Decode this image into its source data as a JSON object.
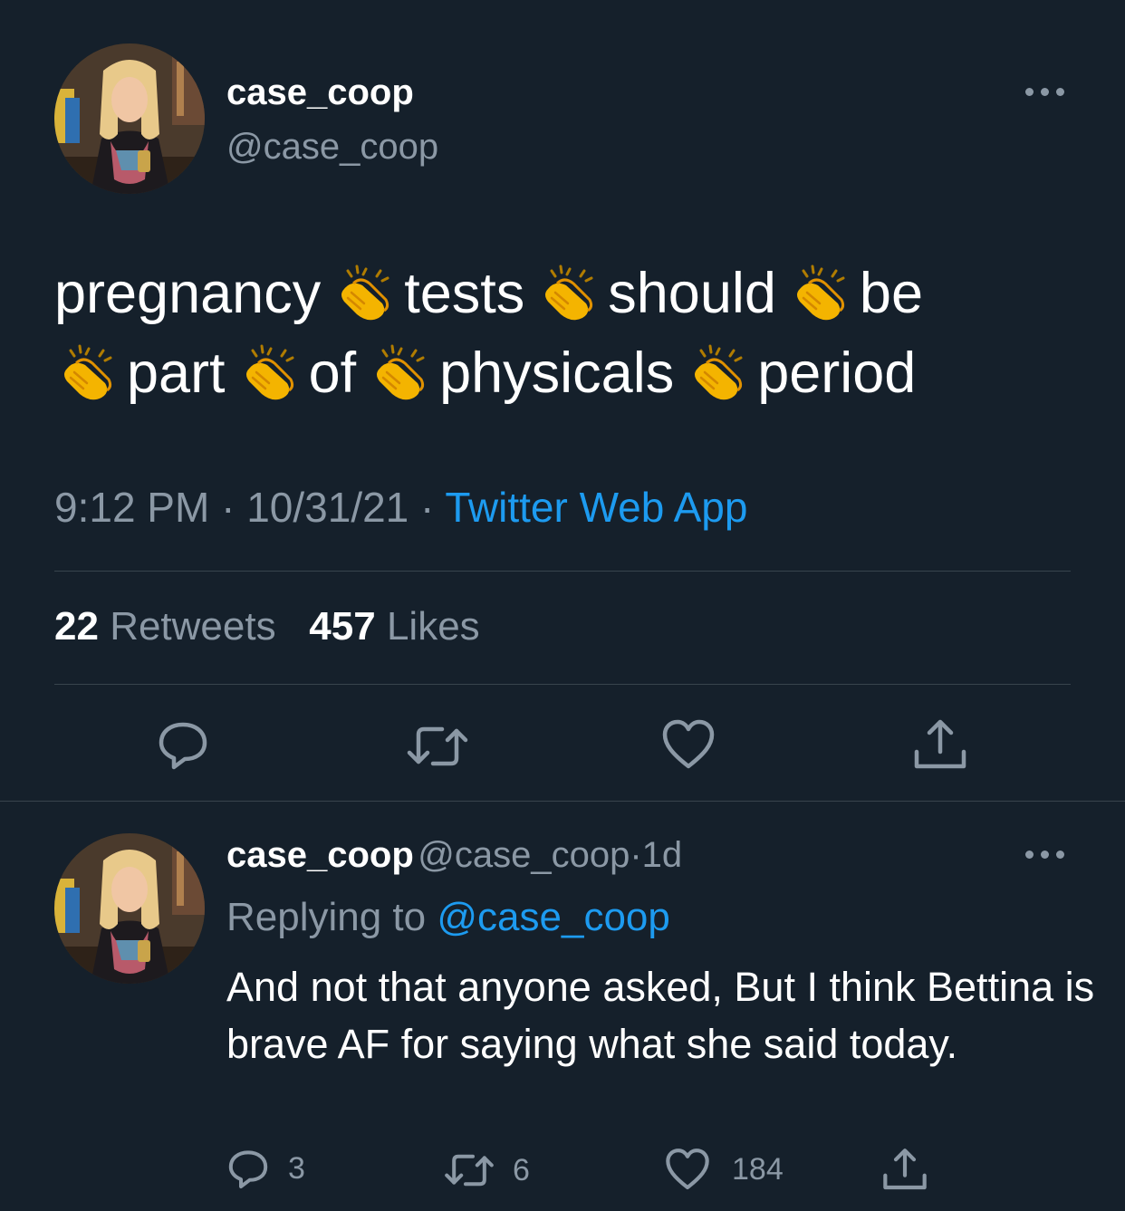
{
  "main_tweet": {
    "display_name": "case_coop",
    "handle": "@case_coop",
    "text_words": [
      "pregnancy",
      "tests",
      "should",
      "be",
      "part",
      "of",
      "physicals",
      "period"
    ],
    "emoji_icon": "clapping-hands-icon",
    "time": "9:12 PM",
    "date": "10/31/21",
    "source": "Twitter Web App",
    "retweet_count": "22",
    "retweet_label": "Retweets",
    "like_count": "457",
    "like_label": "Likes"
  },
  "reply_tweet": {
    "display_name": "case_coop",
    "handle": "@case_coop",
    "age": "1d",
    "replying_prefix": "Replying to",
    "replying_to": "@case_coop",
    "text": "And not that anyone asked, But I think Bettina is brave AF for saying what she said today.",
    "reply_count": "3",
    "retweet_count": "6",
    "like_count": "184"
  },
  "separator": "·",
  "colors": {
    "background": "#15202b",
    "text": "#ffffff",
    "secondary_text": "#8b98a5",
    "accent": "#1d9bf0",
    "divider": "#38444d"
  },
  "icons": [
    "more-icon",
    "reply-icon",
    "retweet-icon",
    "like-icon",
    "share-icon"
  ]
}
